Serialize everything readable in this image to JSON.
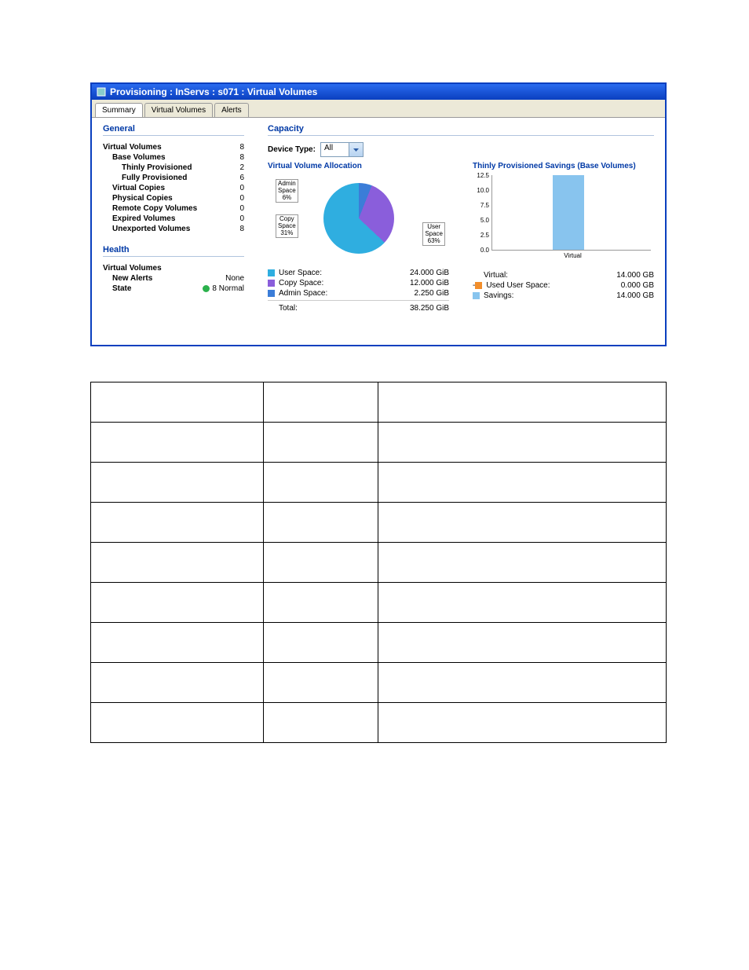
{
  "titlebar": "Provisioning : InServs : s071 : Virtual Volumes",
  "tabs": [
    "Summary",
    "Virtual Volumes",
    "Alerts"
  ],
  "general": {
    "title": "General",
    "rows": [
      {
        "label": "Virtual Volumes",
        "value": "8",
        "indent": 0
      },
      {
        "label": "Base Volumes",
        "value": "8",
        "indent": 1
      },
      {
        "label": "Thinly Provisioned",
        "value": "2",
        "indent": 2
      },
      {
        "label": "Fully Provisioned",
        "value": "6",
        "indent": 2
      },
      {
        "label": "Virtual Copies",
        "value": "0",
        "indent": 1
      },
      {
        "label": "Physical Copies",
        "value": "0",
        "indent": 1
      },
      {
        "label": "Remote Copy Volumes",
        "value": "0",
        "indent": 1
      },
      {
        "label": "Expired Volumes",
        "value": "0",
        "indent": 1
      },
      {
        "label": "Unexported Volumes",
        "value": "8",
        "indent": 1
      }
    ]
  },
  "health": {
    "title": "Health",
    "vv": "Virtual Volumes",
    "alerts_label": "New Alerts",
    "alerts": "None",
    "state_label": "State",
    "state": "8 Normal"
  },
  "capacity": {
    "title": "Capacity",
    "device_label": "Device Type:",
    "device_value": "All",
    "alloc_title": "Virtual Volume Allocation",
    "savings_title": "Thinly Provisioned Savings (Base Volumes)"
  },
  "chart_data": [
    {
      "type": "pie",
      "title": "Virtual Volume Allocation",
      "series": [
        {
          "name": "User Space",
          "value": 24.0,
          "percent": 63,
          "color": "#2faee0",
          "unit": "GiB"
        },
        {
          "name": "Copy Space",
          "value": 12.0,
          "percent": 31,
          "color": "#8a5edb",
          "unit": "GiB"
        },
        {
          "name": "Admin Space",
          "value": 2.25,
          "percent": 6,
          "color": "#3b7dd8",
          "unit": "GiB"
        }
      ],
      "total": {
        "label": "Total:",
        "value": "38.250 GiB"
      },
      "callouts": [
        {
          "text": "Admin Space 6%"
        },
        {
          "text": "Copy Space 31%"
        },
        {
          "text": "User Space 63%"
        }
      ]
    },
    {
      "type": "bar",
      "title": "Thinly Provisioned Savings (Base Volumes)",
      "categories": [
        "Virtual"
      ],
      "values": [
        14.0
      ],
      "ylim": [
        0,
        12.5
      ],
      "yticks": [
        0.0,
        2.5,
        5.0,
        7.5,
        10.0,
        12.5
      ],
      "legend": [
        {
          "name": "Virtual:",
          "value": "14.000 GB",
          "color": null
        },
        {
          "name": "Used User Space:",
          "value": "0.000 GB",
          "color": "#f28e2b",
          "prefix": "- "
        },
        {
          "name": "Savings:",
          "value": "14.000 GB",
          "color": "#88c4ee"
        }
      ]
    }
  ]
}
